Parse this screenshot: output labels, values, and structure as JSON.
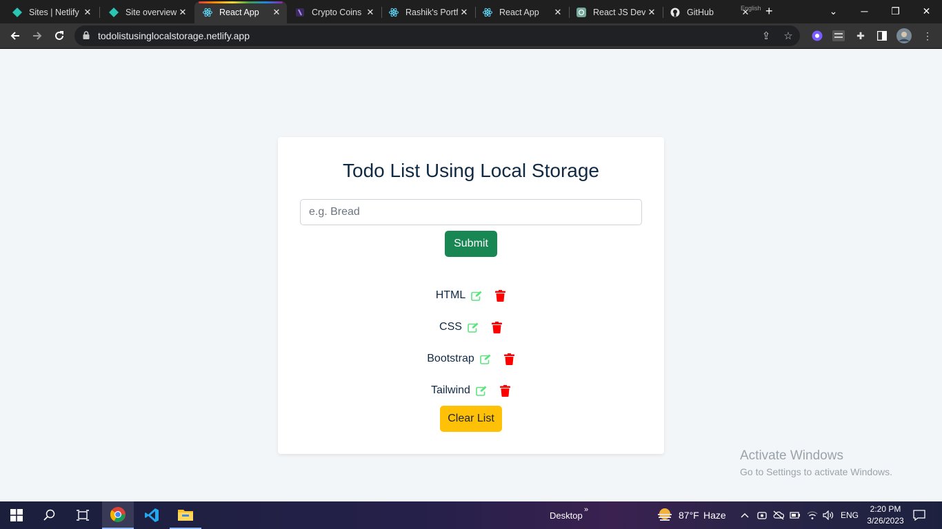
{
  "browser": {
    "tabs": [
      {
        "title": "Sites | Netlify",
        "icon": "netlify-icon"
      },
      {
        "title": "Site overview",
        "icon": "netlify-icon"
      },
      {
        "title": "React App",
        "icon": "react-icon"
      },
      {
        "title": "Crypto Coins",
        "icon": "crypto-icon"
      },
      {
        "title": "Rashik's Portf",
        "icon": "react-icon"
      },
      {
        "title": "React App",
        "icon": "react-icon"
      },
      {
        "title": "React JS Deve",
        "icon": "openai-icon"
      },
      {
        "title": "GitHub",
        "icon": "github-icon"
      }
    ],
    "close_glyph": "✕",
    "overlay_text": "English",
    "url": "todolistusinglocalstorage.netlify.app"
  },
  "app": {
    "title": "Todo List Using Local Storage",
    "input_placeholder": "e.g. Bread",
    "input_value": "",
    "submit_label": "Submit",
    "items": [
      {
        "label": "HTML"
      },
      {
        "label": "CSS"
      },
      {
        "label": "Bootstrap"
      },
      {
        "label": "Tailwind"
      }
    ],
    "clear_label": "Clear List",
    "colors": {
      "submit": "#198754",
      "clear": "#ffc107",
      "edit_icon": "#5be37e",
      "delete_icon": "#ff0000",
      "title": "#102a43"
    }
  },
  "watermark": {
    "line1": "Activate Windows",
    "line2": "Go to Settings to activate Windows."
  },
  "taskbar": {
    "desktop_label": "Desktop",
    "weather": "87°F",
    "weather_desc": "Haze",
    "language": "ENG",
    "time": "2:20 PM",
    "date": "3/26/2023"
  }
}
